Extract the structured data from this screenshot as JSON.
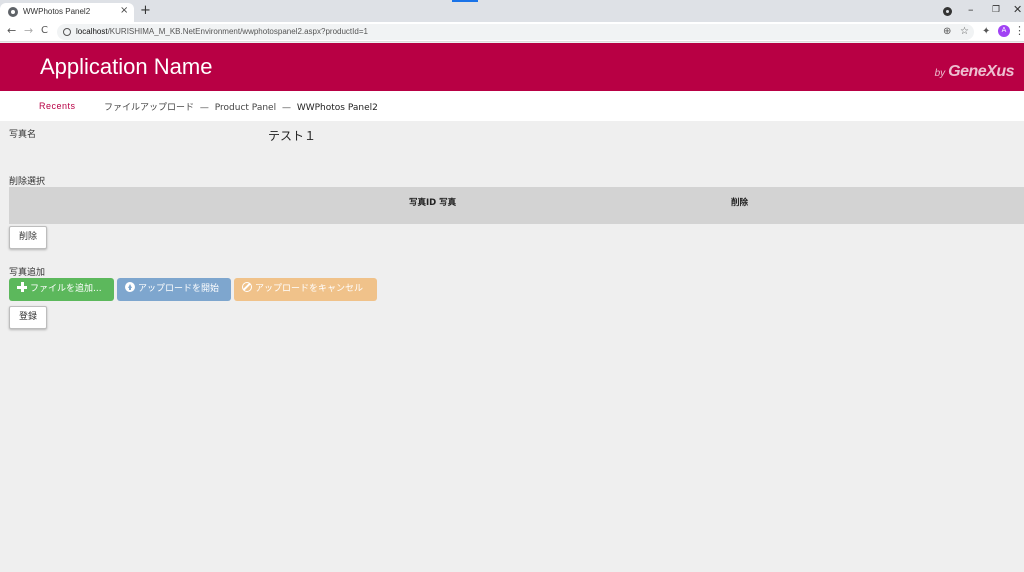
{
  "browser": {
    "tab_title": "WWPhotos Panel2",
    "tab_close": "×",
    "new_tab": "+",
    "nav_back": "←",
    "nav_forward": "→",
    "nav_reload": "C",
    "url_host": "localhost",
    "url_path": "/KURISHIMA_M_KB.NetEnvironment/wwphotospanel2.aspx?productId=1",
    "zoom_icon": "⊕",
    "bookmark_icon": "☆",
    "avatar_letter": "A",
    "win_minimize": "–",
    "win_restore": "❐",
    "win_close": "✕",
    "menu": "⋮"
  },
  "header": {
    "app_name": "Application Name",
    "by": "by",
    "brand": "GeneXus"
  },
  "breadcrumb": {
    "recents": "Recents",
    "items": [
      "ファイルアップロード",
      "Product Panel",
      "WWPhotos Panel2"
    ],
    "separator": "—"
  },
  "form": {
    "photo_name_label": "写真名",
    "photo_name_value": "テスト１",
    "delete_select_label": "削除選択",
    "grid_columns": [
      "写真ID 写真",
      "削除"
    ],
    "delete_button": "削除",
    "add_photo_label": "写真追加",
    "add_files_button": "ファイルを追加...",
    "start_upload_button": "アップロードを開始",
    "cancel_upload_button": "アップロードをキャンセル",
    "register_button": "登録"
  },
  "colors": {
    "brand": "#b80044",
    "success": "#5cb85c",
    "primary": "#7ea6ce",
    "warning": "#f0c28a",
    "grid_header": "#d3d3d3"
  }
}
